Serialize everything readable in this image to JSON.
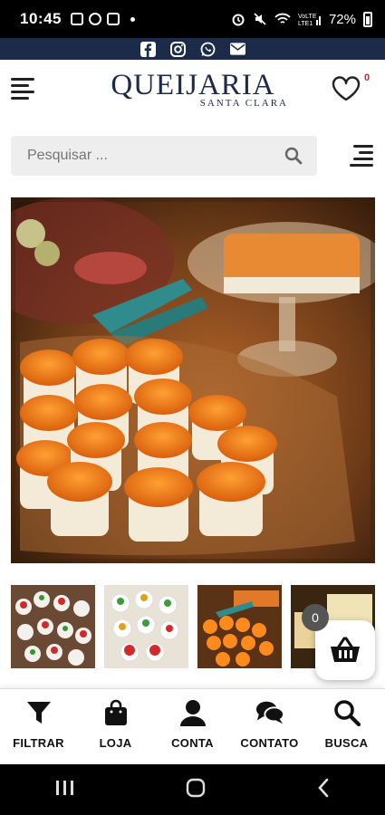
{
  "status_bar": {
    "time": "10:45",
    "battery": "72%"
  },
  "social": {
    "icons": [
      "facebook-icon",
      "instagram-icon",
      "whatsapp-icon",
      "email-icon"
    ]
  },
  "header": {
    "brand": "QUEIJARIA",
    "subtitle": "SANTA CLARA",
    "wishlist_count": "0"
  },
  "search": {
    "placeholder": "Pesquisar ..."
  },
  "cart": {
    "count": "0"
  },
  "bottom_nav": [
    {
      "label": "FILTRAR",
      "icon": "filter-icon"
    },
    {
      "label": "LOJA",
      "icon": "bag-icon"
    },
    {
      "label": "CONTA",
      "icon": "user-icon"
    },
    {
      "label": "CONTATO",
      "icon": "chat-icon"
    },
    {
      "label": "BUSCA",
      "icon": "search-icon"
    }
  ],
  "colors": {
    "brand": "#1c2b4a",
    "accent": "#c0282e"
  }
}
